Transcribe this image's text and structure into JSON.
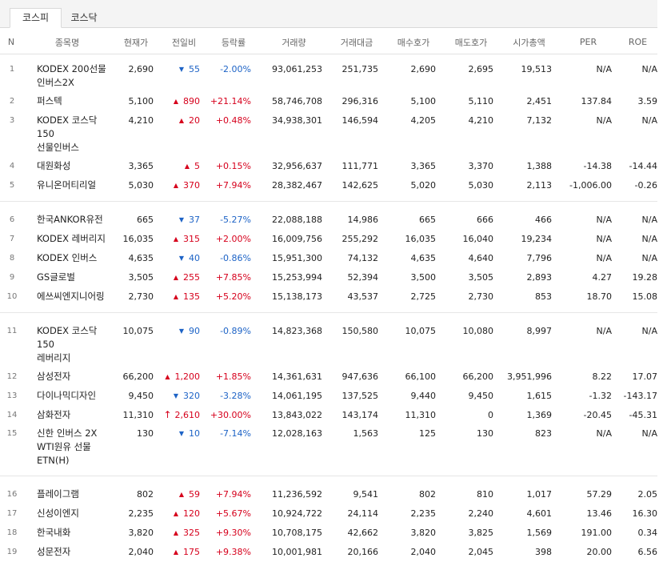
{
  "tabs": [
    {
      "label": "코스피",
      "active": true
    },
    {
      "label": "코스닥",
      "active": false
    }
  ],
  "columns": [
    "N",
    "종목명",
    "현재가",
    "전일비",
    "등락률",
    "거래량",
    "거래대금",
    "매수호가",
    "매도호가",
    "시가총액",
    "PER",
    "ROE"
  ],
  "colors": {
    "up": "#d6001c",
    "down": "#1d63c6"
  },
  "groups": [
    [
      {
        "n": "1",
        "name": "KODEX 200선물\n인버스2X",
        "price": "2,690",
        "dir": "down",
        "diff": "55",
        "rate": "-2.00%",
        "volume": "93,061,253",
        "amount": "251,735",
        "bid": "2,690",
        "ask": "2,695",
        "mcap": "19,513",
        "per": "N/A",
        "roe": "N/A"
      },
      {
        "n": "2",
        "name": "퍼스텍",
        "price": "5,100",
        "dir": "up",
        "diff": "890",
        "rate": "+21.14%",
        "volume": "58,746,708",
        "amount": "296,316",
        "bid": "5,100",
        "ask": "5,110",
        "mcap": "2,451",
        "per": "137.84",
        "roe": "3.59"
      },
      {
        "n": "3",
        "name": "KODEX 코스닥150\n선물인버스",
        "price": "4,210",
        "dir": "up",
        "diff": "20",
        "rate": "+0.48%",
        "volume": "34,938,301",
        "amount": "146,594",
        "bid": "4,205",
        "ask": "4,210",
        "mcap": "7,132",
        "per": "N/A",
        "roe": "N/A"
      },
      {
        "n": "4",
        "name": "대원화성",
        "price": "3,365",
        "dir": "up",
        "diff": "5",
        "rate": "+0.15%",
        "volume": "32,956,637",
        "amount": "111,771",
        "bid": "3,365",
        "ask": "3,370",
        "mcap": "1,388",
        "per": "-14.38",
        "roe": "-14.44"
      },
      {
        "n": "5",
        "name": "유니온머티리얼",
        "price": "5,030",
        "dir": "up",
        "diff": "370",
        "rate": "+7.94%",
        "volume": "28,382,467",
        "amount": "142,625",
        "bid": "5,020",
        "ask": "5,030",
        "mcap": "2,113",
        "per": "-1,006.00",
        "roe": "-0.26"
      }
    ],
    [
      {
        "n": "6",
        "name": "한국ANKOR유전",
        "price": "665",
        "dir": "down",
        "diff": "37",
        "rate": "-5.27%",
        "volume": "22,088,188",
        "amount": "14,986",
        "bid": "665",
        "ask": "666",
        "mcap": "466",
        "per": "N/A",
        "roe": "N/A"
      },
      {
        "n": "7",
        "name": "KODEX 레버리지",
        "price": "16,035",
        "dir": "up",
        "diff": "315",
        "rate": "+2.00%",
        "volume": "16,009,756",
        "amount": "255,292",
        "bid": "16,035",
        "ask": "16,040",
        "mcap": "19,234",
        "per": "N/A",
        "roe": "N/A"
      },
      {
        "n": "8",
        "name": "KODEX 인버스",
        "price": "4,635",
        "dir": "down",
        "diff": "40",
        "rate": "-0.86%",
        "volume": "15,951,300",
        "amount": "74,132",
        "bid": "4,635",
        "ask": "4,640",
        "mcap": "7,796",
        "per": "N/A",
        "roe": "N/A"
      },
      {
        "n": "9",
        "name": "GS글로벌",
        "price": "3,505",
        "dir": "up",
        "diff": "255",
        "rate": "+7.85%",
        "volume": "15,253,994",
        "amount": "52,394",
        "bid": "3,500",
        "ask": "3,505",
        "mcap": "2,893",
        "per": "4.27",
        "roe": "19.28"
      },
      {
        "n": "10",
        "name": "에쓰씨엔지니어링",
        "price": "2,730",
        "dir": "up",
        "diff": "135",
        "rate": "+5.20%",
        "volume": "15,138,173",
        "amount": "43,537",
        "bid": "2,725",
        "ask": "2,730",
        "mcap": "853",
        "per": "18.70",
        "roe": "15.08"
      }
    ],
    [
      {
        "n": "11",
        "name": "KODEX 코스닥150\n레버리지",
        "price": "10,075",
        "dir": "down",
        "diff": "90",
        "rate": "-0.89%",
        "volume": "14,823,368",
        "amount": "150,580",
        "bid": "10,075",
        "ask": "10,080",
        "mcap": "8,997",
        "per": "N/A",
        "roe": "N/A"
      },
      {
        "n": "12",
        "name": "삼성전자",
        "price": "66,200",
        "dir": "up",
        "diff": "1,200",
        "rate": "+1.85%",
        "volume": "14,361,631",
        "amount": "947,636",
        "bid": "66,100",
        "ask": "66,200",
        "mcap": "3,951,996",
        "per": "8.22",
        "roe": "17.07"
      },
      {
        "n": "13",
        "name": "다이나믹디자인",
        "price": "9,450",
        "dir": "down",
        "diff": "320",
        "rate": "-3.28%",
        "volume": "14,061,195",
        "amount": "137,525",
        "bid": "9,440",
        "ask": "9,450",
        "mcap": "1,615",
        "per": "-1.32",
        "roe": "-143.17"
      },
      {
        "n": "14",
        "name": "삼화전자",
        "price": "11,310",
        "dir": "limit",
        "diff": "2,610",
        "rate": "+30.00%",
        "volume": "13,843,022",
        "amount": "143,174",
        "bid": "11,310",
        "ask": "0",
        "mcap": "1,369",
        "per": "-20.45",
        "roe": "-45.31"
      },
      {
        "n": "15",
        "name": "신한 인버스 2X\nWTI원유 선물\nETN(H)",
        "price": "130",
        "dir": "down",
        "diff": "10",
        "rate": "-7.14%",
        "volume": "12,028,163",
        "amount": "1,563",
        "bid": "125",
        "ask": "130",
        "mcap": "823",
        "per": "N/A",
        "roe": "N/A"
      }
    ],
    [
      {
        "n": "16",
        "name": "플레이그램",
        "price": "802",
        "dir": "up",
        "diff": "59",
        "rate": "+7.94%",
        "volume": "11,236,592",
        "amount": "9,541",
        "bid": "802",
        "ask": "810",
        "mcap": "1,017",
        "per": "57.29",
        "roe": "2.05"
      },
      {
        "n": "17",
        "name": "신성이엔지",
        "price": "2,235",
        "dir": "up",
        "diff": "120",
        "rate": "+5.67%",
        "volume": "10,924,722",
        "amount": "24,114",
        "bid": "2,235",
        "ask": "2,240",
        "mcap": "4,601",
        "per": "13.46",
        "roe": "16.30"
      },
      {
        "n": "18",
        "name": "한국내화",
        "price": "3,820",
        "dir": "up",
        "diff": "325",
        "rate": "+9.30%",
        "volume": "10,708,175",
        "amount": "42,662",
        "bid": "3,820",
        "ask": "3,825",
        "mcap": "1,569",
        "per": "191.00",
        "roe": "0.34"
      },
      {
        "n": "19",
        "name": "성문전자",
        "price": "2,040",
        "dir": "up",
        "diff": "175",
        "rate": "+9.38%",
        "volume": "10,001,981",
        "amount": "20,166",
        "bid": "2,040",
        "ask": "2,045",
        "mcap": "398",
        "per": "20.00",
        "roe": "6.56"
      }
    ]
  ]
}
